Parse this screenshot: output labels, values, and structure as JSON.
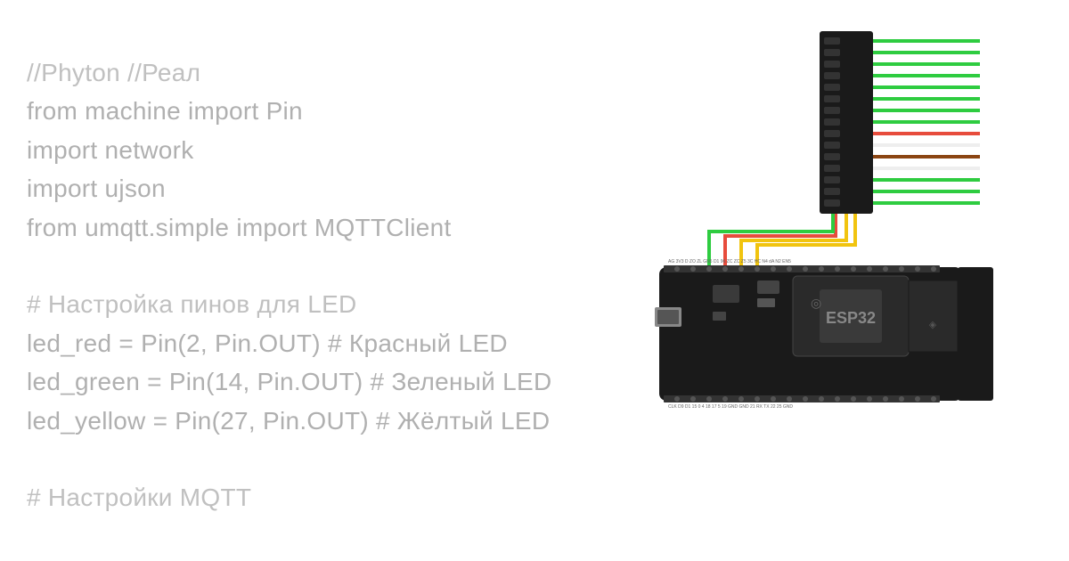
{
  "code": {
    "header": {
      "line1": "//Phyton          //Реал",
      "line2": "from machine import Pin",
      "line3": "import network",
      "line4": "import ujson",
      "line5": "from umqtt.simple import MQTTClient"
    },
    "section1_comment": "# Настройка пинов для LED",
    "section1": {
      "line1": "led_red =    Pin(2,  Pin.OUT)  # Красный LED",
      "line2": "led_green =  Pin(14, Pin.OUT)  # Зеленый LED",
      "line3": "led_yellow = Pin(27, Pin.OUT)  # Жёлтый  LED"
    },
    "section2_comment": "# Настройки MQTT"
  },
  "colors": {
    "text": "#b5b5b5",
    "comment": "#c8c8c8",
    "wire_green": "#2ecc40",
    "wire_red": "#e74c3c",
    "wire_yellow": "#f1c40f",
    "wire_white": "#eeeeee",
    "wire_brown": "#8B4513",
    "board_dark": "#1a1a1a",
    "board_text": "#cccccc"
  }
}
